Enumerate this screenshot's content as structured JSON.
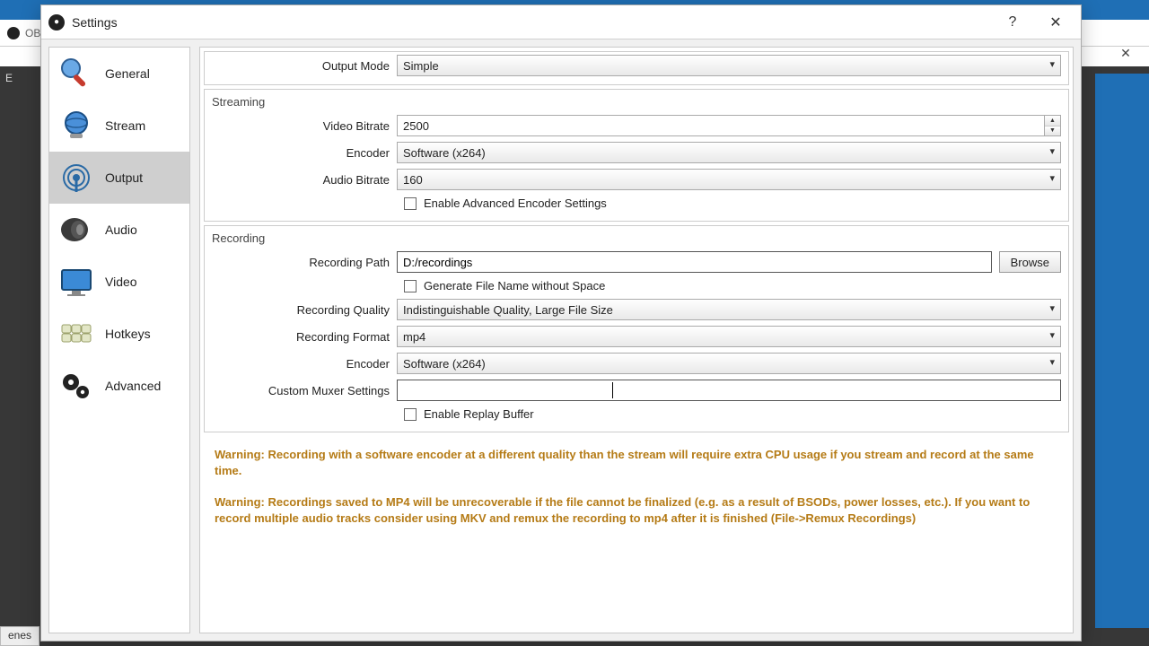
{
  "bg": {
    "title": "OBS",
    "close": "✕",
    "menu": "E",
    "tab": "enes"
  },
  "dialog": {
    "title": "Settings",
    "help": "?",
    "close": "✕"
  },
  "sidebar": {
    "items": [
      {
        "label": "General"
      },
      {
        "label": "Stream"
      },
      {
        "label": "Output"
      },
      {
        "label": "Audio"
      },
      {
        "label": "Video"
      },
      {
        "label": "Hotkeys"
      },
      {
        "label": "Advanced"
      }
    ]
  },
  "output_mode": {
    "label": "Output Mode",
    "value": "Simple"
  },
  "streaming": {
    "title": "Streaming",
    "video_bitrate": {
      "label": "Video Bitrate",
      "value": "2500"
    },
    "encoder": {
      "label": "Encoder",
      "value": "Software (x264)"
    },
    "audio_bitrate": {
      "label": "Audio Bitrate",
      "value": "160"
    },
    "enable_advanced": "Enable Advanced Encoder Settings"
  },
  "recording": {
    "title": "Recording",
    "path": {
      "label": "Recording Path",
      "value": "D:/recordings",
      "browse": "Browse"
    },
    "gen_filename": "Generate File Name without Space",
    "quality": {
      "label": "Recording Quality",
      "value": "Indistinguishable Quality, Large File Size"
    },
    "format": {
      "label": "Recording Format",
      "value": "mp4"
    },
    "encoder": {
      "label": "Encoder",
      "value": "Software (x264)"
    },
    "muxer": {
      "label": "Custom Muxer Settings",
      "value": ""
    },
    "replay_buffer": "Enable Replay Buffer"
  },
  "warnings": {
    "w1": "Warning: Recording with a software encoder at a different quality than the stream will require extra CPU usage if you stream and record at the same time.",
    "w2": "Warning: Recordings saved to MP4 will be unrecoverable if the file cannot be finalized (e.g. as a result of BSODs, power losses, etc.). If you want to record multiple audio tracks consider using MKV and remux the recording to mp4 after it is finished (File->Remux Recordings)"
  }
}
